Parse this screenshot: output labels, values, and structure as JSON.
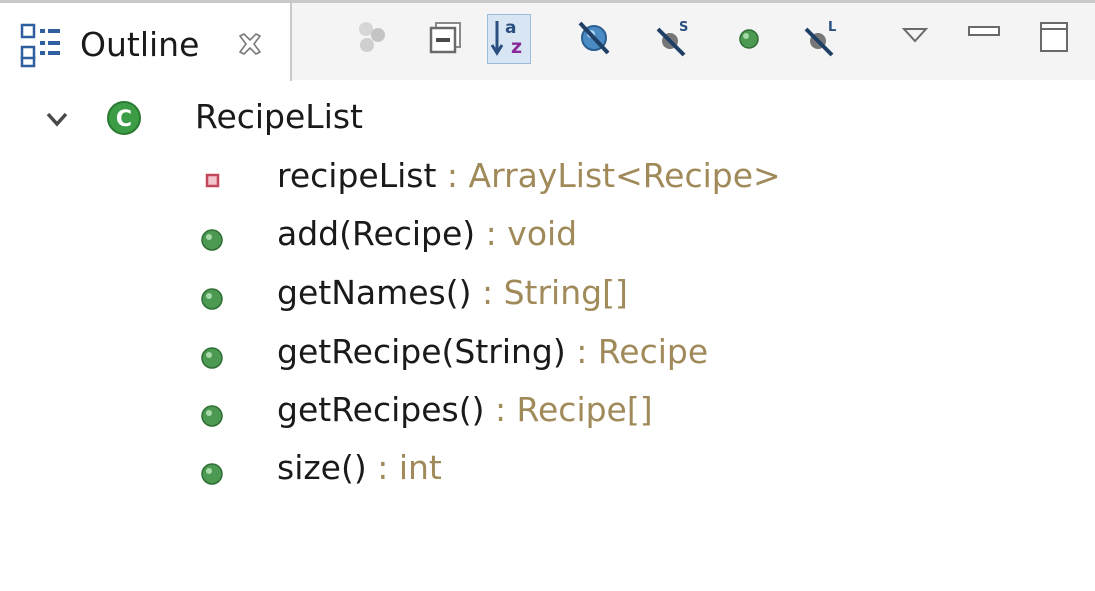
{
  "view": {
    "title": "Outline",
    "icon": "outline-view-icon",
    "close_icon": "close-x-icon"
  },
  "toolbar": {
    "buttons": [
      {
        "name": "focus-active-task-icon",
        "state": "disabled"
      },
      {
        "name": "collapse-all-icon",
        "state": "normal"
      },
      {
        "name": "sort-alphabetically-icon",
        "state": "pressed"
      },
      {
        "name": "hide-fields-icon",
        "state": "normal"
      },
      {
        "name": "hide-static-members-icon",
        "state": "normal"
      },
      {
        "name": "hide-non-public-members-icon",
        "state": "normal"
      },
      {
        "name": "hide-local-types-icon",
        "state": "normal"
      },
      {
        "name": "view-menu-icon",
        "state": "normal"
      },
      {
        "name": "minimize-icon",
        "state": "normal"
      },
      {
        "name": "maximize-icon",
        "state": "normal"
      }
    ]
  },
  "tree": {
    "root": {
      "label": "RecipeList",
      "icon": "public-class-icon",
      "expanded": true
    },
    "members": [
      {
        "name": "recipeList",
        "type": " : ArrayList<Recipe>",
        "icon": "private-field-icon",
        "color": "#c0485a"
      },
      {
        "name": "add(Recipe)",
        "type": " : void",
        "icon": "public-method-icon",
        "color": "#3e9a48"
      },
      {
        "name": "getNames()",
        "type": " : String[]",
        "icon": "public-method-icon",
        "color": "#3e9a48"
      },
      {
        "name": "getRecipe(String)",
        "type": " : Recipe",
        "icon": "public-method-icon",
        "color": "#3e9a48"
      },
      {
        "name": "getRecipes()",
        "type": " : Recipe[]",
        "icon": "public-method-icon",
        "color": "#3e9a48"
      },
      {
        "name": "size()",
        "type": " : int",
        "icon": "public-method-icon",
        "color": "#3e9a48"
      }
    ]
  },
  "colors": {
    "type_text": "#a08a5a",
    "method_green": "#3e9a48",
    "field_red": "#c0485a"
  }
}
